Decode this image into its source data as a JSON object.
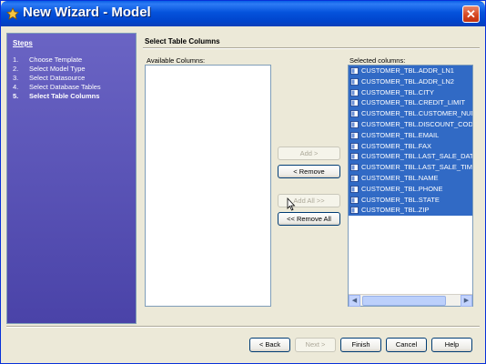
{
  "window": {
    "title": "New Wizard - Model",
    "close_label": "✕"
  },
  "sidebar": {
    "title": "Steps",
    "steps": [
      {
        "num": "1.",
        "label": "Choose Template"
      },
      {
        "num": "2.",
        "label": "Select Model Type"
      },
      {
        "num": "3.",
        "label": "Select Datasource"
      },
      {
        "num": "4.",
        "label": "Select Database Tables"
      },
      {
        "num": "5.",
        "label": "Select Table Columns"
      }
    ],
    "active_step": 4
  },
  "main": {
    "title": "Select Table Columns",
    "available_label": "Available Columns:",
    "selected_label": "Selected columns:",
    "selected_columns": [
      "CUSTOMER_TBL.ADDR_LN1",
      "CUSTOMER_TBL.ADDR_LN2",
      "CUSTOMER_TBL.CITY",
      "CUSTOMER_TBL.CREDIT_LIMIT",
      "CUSTOMER_TBL.CUSTOMER_NUM",
      "CUSTOMER_TBL.DISCOUNT_CODE",
      "CUSTOMER_TBL.EMAIL",
      "CUSTOMER_TBL.FAX",
      "CUSTOMER_TBL.LAST_SALE_DATE",
      "CUSTOMER_TBL.LAST_SALE_TIME",
      "CUSTOMER_TBL.NAME",
      "CUSTOMER_TBL.PHONE",
      "CUSTOMER_TBL.STATE",
      "CUSTOMER_TBL.ZIP"
    ],
    "buttons": {
      "add": "Add >",
      "remove": "< Remove",
      "add_all": "Add All >>",
      "remove_all": "<< Remove All"
    }
  },
  "footer": {
    "back": "< Back",
    "next": "Next >",
    "finish": "Finish",
    "cancel": "Cancel",
    "help": "Help"
  }
}
